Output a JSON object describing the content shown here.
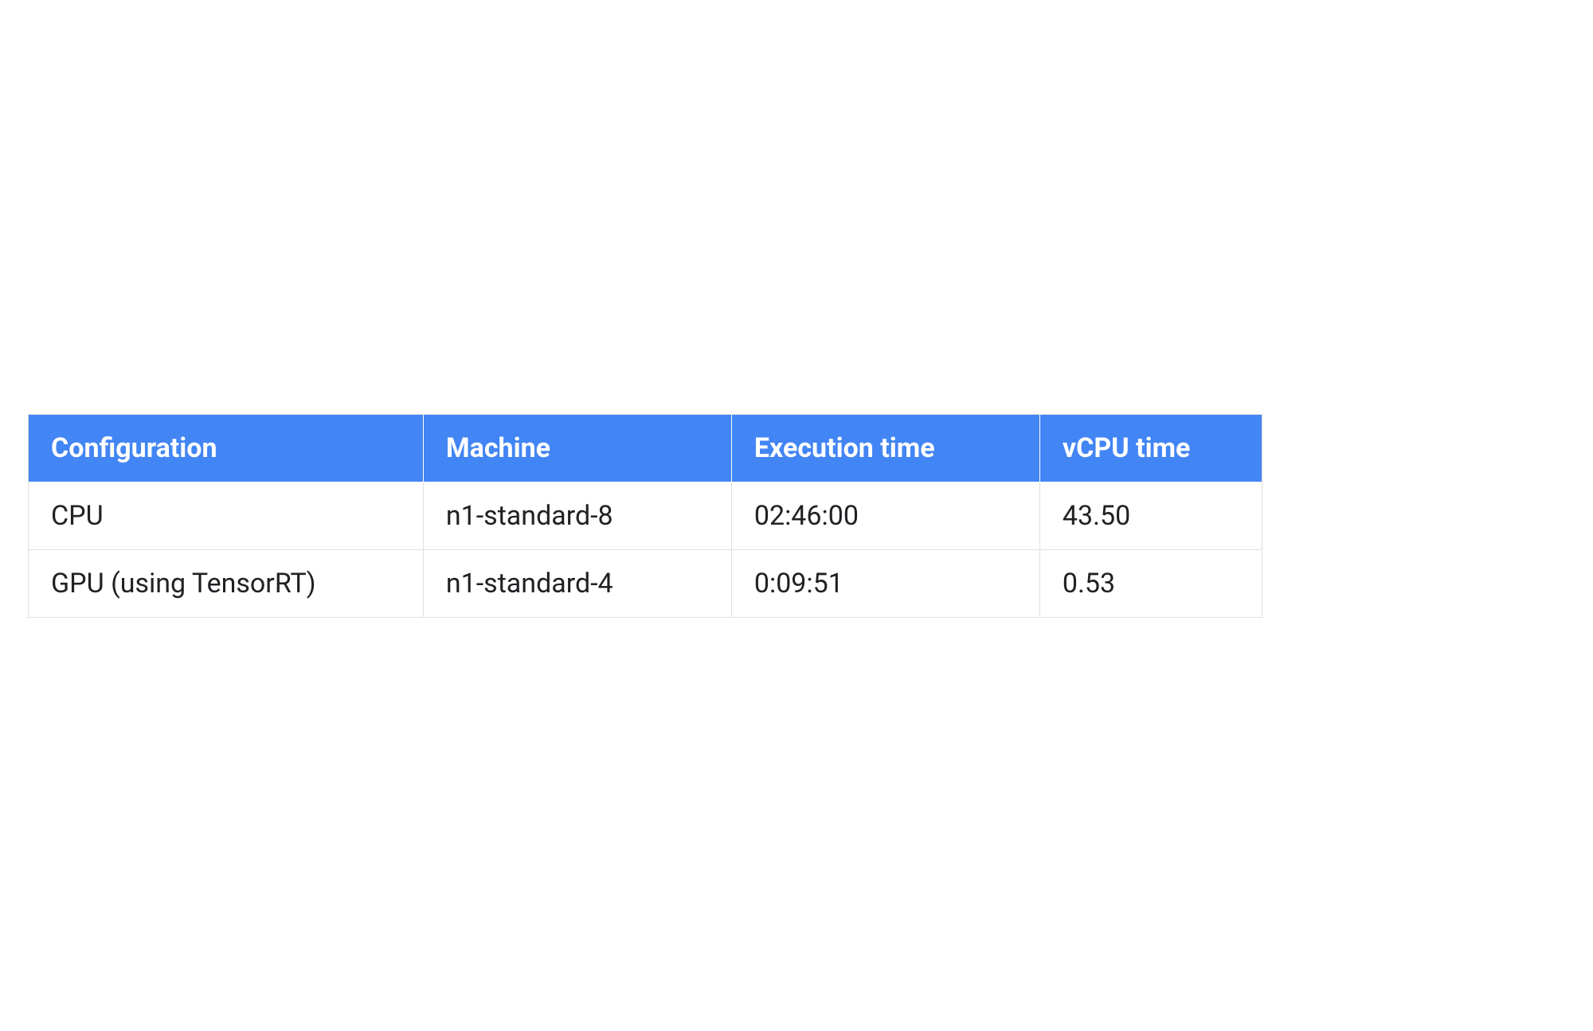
{
  "chart_data": {
    "type": "table",
    "title": "",
    "columns": [
      "Configuration",
      "Machine",
      "Execution time",
      "vCPU time"
    ],
    "rows": [
      {
        "configuration": "CPU",
        "machine": "n1-standard-8",
        "execution_time": "02:46:00",
        "vcpu_time": "43.50"
      },
      {
        "configuration": "GPU (using TensorRT)",
        "machine": "n1-standard-4",
        "execution_time": "0:09:51",
        "vcpu_time": "0.53"
      }
    ]
  },
  "table": {
    "headers": {
      "configuration": "Configuration",
      "machine": "Machine",
      "execution_time": "Execution time",
      "vcpu_time": "vCPU time"
    },
    "rows": [
      {
        "configuration": "CPU",
        "machine": "n1-standard-8",
        "execution_time": "02:46:00",
        "vcpu_time": "43.50"
      },
      {
        "configuration": "GPU (using TensorRT)",
        "machine": "n1-standard-4",
        "execution_time": "0:09:51",
        "vcpu_time": "0.53"
      }
    ]
  }
}
